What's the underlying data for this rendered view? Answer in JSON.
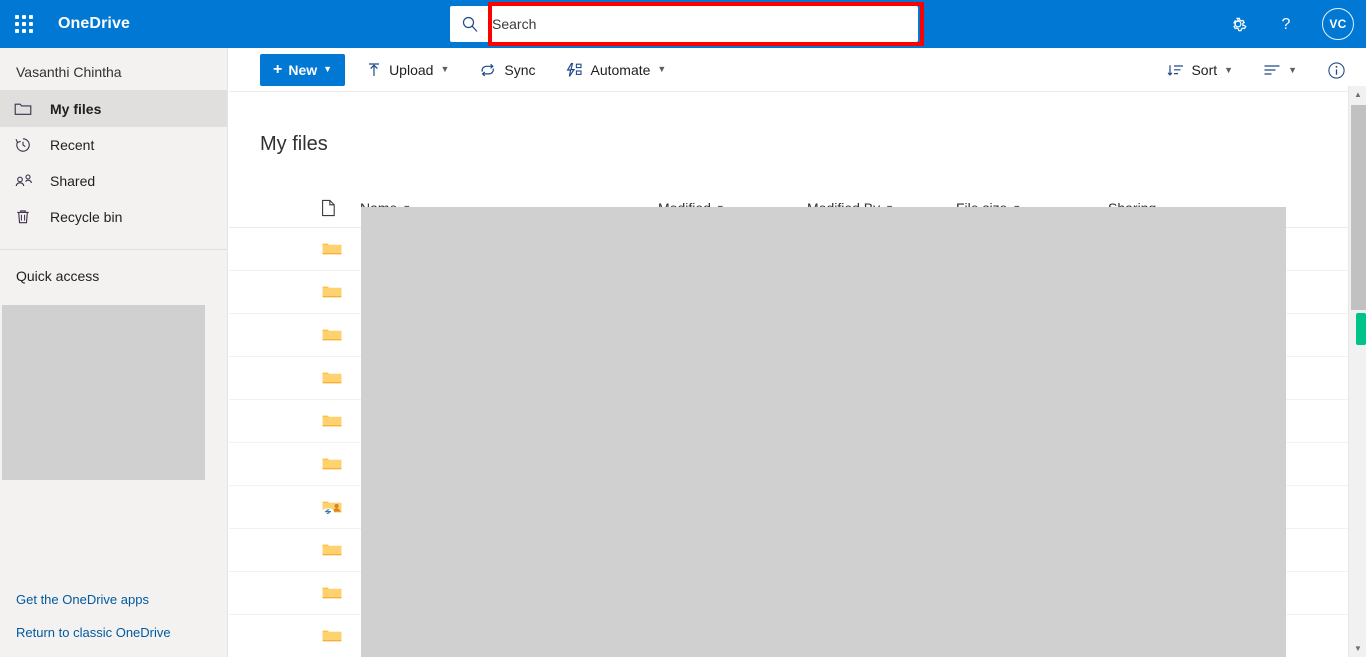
{
  "header": {
    "waffle_label": "app-launcher",
    "brand": "OneDrive",
    "search": {
      "placeholder": "Search",
      "value": ""
    },
    "settings_label": "Settings",
    "help_label": "Help",
    "avatar_initials": "VC"
  },
  "sidebar": {
    "account_name": "Vasanthi Chintha",
    "items": [
      {
        "label": "My files",
        "icon": "folder-icon",
        "active": true
      },
      {
        "label": "Recent",
        "icon": "clock-icon",
        "active": false
      },
      {
        "label": "Shared",
        "icon": "people-icon",
        "active": false
      },
      {
        "label": "Recycle bin",
        "icon": "trash-icon",
        "active": false
      }
    ],
    "quick_access_title": "Quick access",
    "links": [
      {
        "label": "Get the OneDrive apps"
      },
      {
        "label": "Return to classic OneDrive"
      }
    ]
  },
  "commandbar": {
    "new_label": "New",
    "upload_label": "Upload",
    "sync_label": "Sync",
    "automate_label": "Automate",
    "sort_label": "Sort",
    "view_label": "view-options",
    "info_label": "Details"
  },
  "main": {
    "page_title": "My files",
    "columns": [
      {
        "label": "Name",
        "sortable": true
      },
      {
        "label": "Modified",
        "sortable": true
      },
      {
        "label": "Modified By",
        "sortable": true
      },
      {
        "label": "File size",
        "sortable": true
      },
      {
        "label": "Sharing",
        "sortable": false
      }
    ],
    "rows": [
      {
        "icon": "folder-icon"
      },
      {
        "icon": "folder-icon"
      },
      {
        "icon": "folder-icon"
      },
      {
        "icon": "folder-icon"
      },
      {
        "icon": "folder-icon"
      },
      {
        "icon": "folder-icon"
      },
      {
        "icon": "shared-folder-icon"
      },
      {
        "icon": "folder-icon"
      },
      {
        "icon": "folder-icon"
      },
      {
        "icon": "folder-icon"
      }
    ]
  },
  "scrollbar": {
    "up_glyph": "▲",
    "down_glyph": "▼"
  },
  "colors": {
    "brand_blue": "#0078d4",
    "sidebar_bg": "#f3f2f1",
    "active_item": "#e1dfdd",
    "annotation_red": "#ff0000",
    "scroll_marker_green": "#00c38a",
    "redaction_gray": "#d0d0d0"
  }
}
